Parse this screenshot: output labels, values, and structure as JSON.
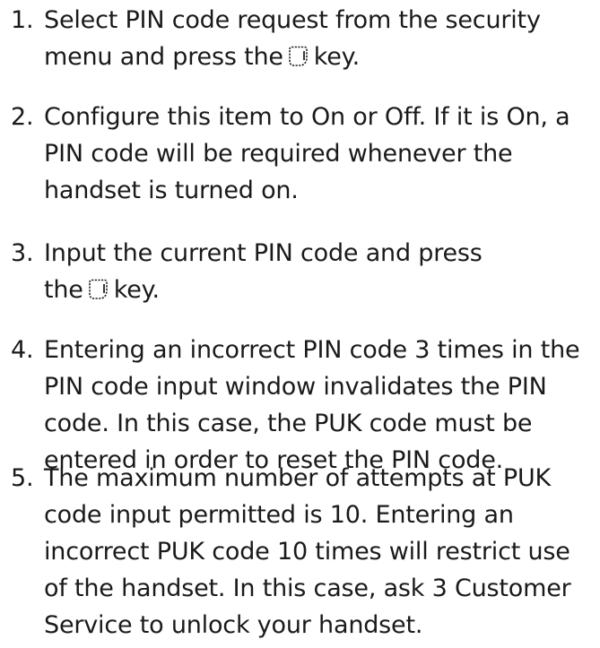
{
  "steps": [
    {
      "number": "1.",
      "lines": [
        "Select PIN code request from the security",
        "menu and press the",
        "key."
      ],
      "icon": "soft-key-icon"
    },
    {
      "number": "2.",
      "lines": [
        "Configure this item to On or Off. If it is On, a",
        "PIN code will be required whenever the",
        "handset is turned on."
      ]
    },
    {
      "number": "3.",
      "lines": [
        "Input the current PIN code and press",
        "the",
        "key."
      ],
      "icon": "soft-key-icon"
    },
    {
      "number": "4.",
      "lines": [
        "Entering an incorrect PIN code 3 times in the",
        "PIN code input window invalidates the PIN",
        "code. In this case, the PUK code must be",
        "entered in order to reset the PIN code."
      ]
    },
    {
      "number": "5.",
      "lines": [
        "The maximum number of attempts at PUK",
        "code input permitted is 10. Entering an",
        "incorrect PUK code 10 times will restrict use",
        "of the handset. In this case, ask 3 Customer",
        "Service to unlock your handset."
      ]
    }
  ]
}
